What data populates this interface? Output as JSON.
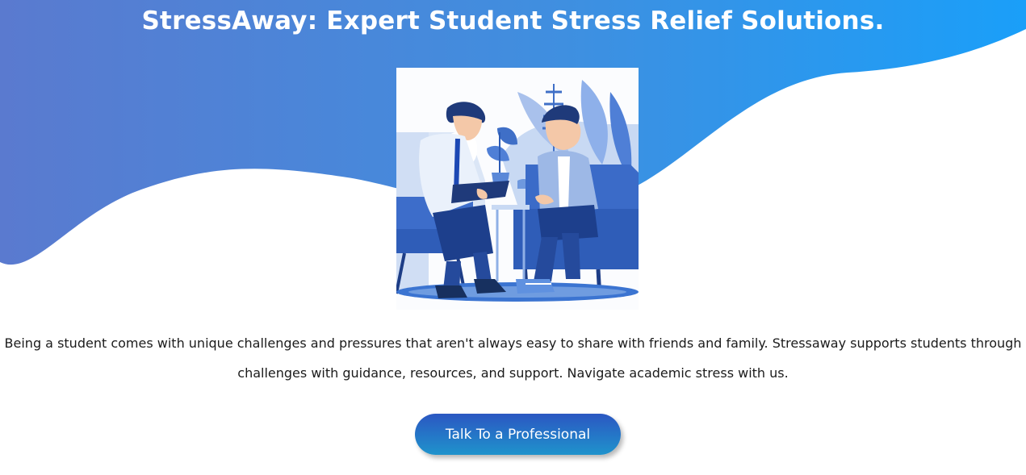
{
  "header": {
    "title": "StressAway: Expert Student Stress Relief Solutions."
  },
  "hero": {
    "illustration": "counselor-and-student-illustration",
    "colors": {
      "gradient_start": "#5a7bcf",
      "gradient_end": "#1a9ef8"
    }
  },
  "intro": {
    "text_line1": "Being a student comes with unique challenges and pressures that aren't always easy to share with friends and family. Stressaway supports students through",
    "text_line2": "challenges with guidance, resources, and support. Navigate academic stress with us."
  },
  "cta": {
    "label": "Talk To a Professional"
  }
}
